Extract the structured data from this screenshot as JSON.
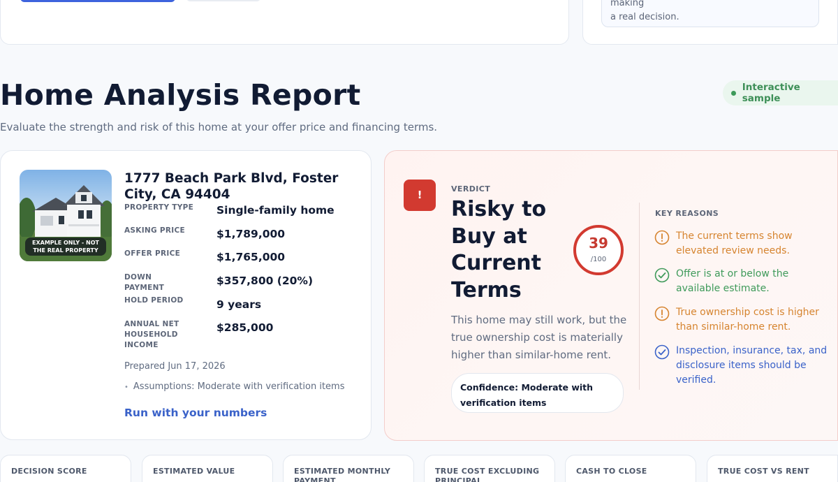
{
  "top": {
    "note_line1": "Treat this as the verification list before making",
    "note_line2": "a real decision."
  },
  "header": {
    "title": "Home Analysis Report",
    "subtitle": "Evaluate the strength and risk of this home at your offer price and financing terms.",
    "badge": "Interactive sample"
  },
  "property": {
    "image_label_line1": "EXAMPLE ONLY - NOT",
    "image_label_line2": "THE REAL PROPERTY",
    "address": "1777 Beach Park Blvd, Foster City, CA 94404",
    "fields": [
      {
        "label": "PROPERTY TYPE",
        "value": "Single-family home"
      },
      {
        "label": "ASKING PRICE",
        "value": "$1,789,000"
      },
      {
        "label": "OFFER PRICE",
        "value": "$1,765,000"
      },
      {
        "label": "DOWN PAYMENT",
        "value": "$357,800 (20%)"
      },
      {
        "label": "HOLD PERIOD",
        "value": "9 years"
      },
      {
        "label": "ANNUAL NET HOUSEHOLD INCOME",
        "value": "$285,000"
      }
    ],
    "prepared": "Prepared Jun 17, 2026",
    "assumptions": "Assumptions: Moderate with verification items",
    "run_link": "Run with your numbers"
  },
  "verdict": {
    "icon_glyph": "!",
    "eyebrow": "VERDICT",
    "title": "Risky to Buy at Current Terms",
    "score": "39",
    "score_max": "/100",
    "score_fraction": 0.39,
    "description": "This home may still work, but the true ownership cost is materially higher than similar-home rent.",
    "confidence": "Confidence: Moderate with verification items",
    "reasons_title": "KEY REASONS",
    "reasons": [
      {
        "type": "warning",
        "icon": "alert-circle-icon",
        "text": "The current terms show elevated review needs."
      },
      {
        "type": "ok",
        "icon": "check-circle-icon",
        "text": "Offer is at or below the available estimate."
      },
      {
        "type": "warning",
        "icon": "alert-circle-icon",
        "text": "True ownership cost is higher than similar-home rent."
      },
      {
        "type": "info",
        "icon": "check-circle-icon",
        "text": "Inspection, insurance, tax, and disclosure items should be verified."
      }
    ]
  },
  "metrics": [
    {
      "label": "DECISION SCORE"
    },
    {
      "label": "ESTIMATED VALUE"
    },
    {
      "label": "ESTIMATED MONTHLY PAYMENT"
    },
    {
      "label": "TRUE COST EXCLUDING PRINCIPAL"
    },
    {
      "label": "CASH TO CLOSE"
    },
    {
      "label": "TRUE COST VS RENT"
    }
  ],
  "colors": {
    "accent": "#3a62c9",
    "danger": "#d23a30",
    "warning": "#d6842f",
    "success": "#3f9a5a",
    "badge_green": "#3d8f57"
  }
}
